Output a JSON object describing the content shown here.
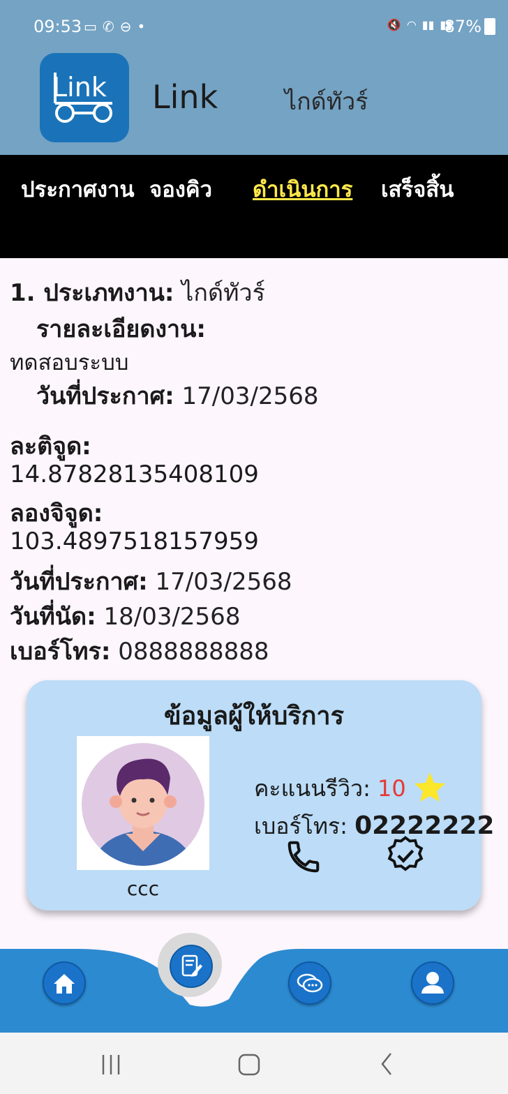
{
  "status_bar": {
    "time": "09:53",
    "battery": "87%",
    "left_icons": [
      "video-icon",
      "missed-call-icon",
      "dnd-icon",
      "dot-icon"
    ],
    "right_icons": [
      "mute-icon",
      "wifi-icon",
      "signal-lte1-icon",
      "signal-lte2-icon"
    ]
  },
  "header": {
    "logo_text": "Link",
    "app_name": "Link",
    "category": "ไกด์ทัวร์"
  },
  "tabs": [
    {
      "label": "ประกาศงาน",
      "active": false
    },
    {
      "label": "จองคิว",
      "active": false
    },
    {
      "label": "ดำเนินการ",
      "active": true
    },
    {
      "label": "เสร็จสิ้น",
      "active": false
    }
  ],
  "job": {
    "type_label": "1. ประเภทงาน:",
    "type_value": " ไกด์ทัวร์",
    "detail_label": "รายละเอียดงาน:",
    "detail_value": "ทดสอบระบบ",
    "announce_label_1": "วันที่ประกาศ:",
    "announce_value_1": " 17/03/2568",
    "lat_label": "ละติจูด:",
    "lat_value": "14.87828135408109",
    "lng_label": "ลองจิจูด:",
    "lng_value": "103.4897518157959",
    "announce_label_2": "วันที่ประกาศ:",
    "announce_value_2": " 17/03/2568",
    "appoint_label": "วันที่นัด:",
    "appoint_value": " 18/03/2568",
    "phone_label": "เบอร์โทร:",
    "phone_value": " 0888888888"
  },
  "provider": {
    "title": "ข้อมูลผู้ให้บริการ",
    "name": "ccc",
    "review_label": "คะแนนรีวิว: ",
    "review_score": "10",
    "phone_label": "เบอร์โทร: ",
    "phone_value": "02222222"
  },
  "colors": {
    "header_bg": "#74a3c4",
    "tabs_bg": "#000000",
    "active_tab": "#ffe84a",
    "card_bg": "#bcdcf7",
    "nav_bg": "#2c8ad0",
    "score": "#e53935",
    "star": "#fde72a"
  }
}
